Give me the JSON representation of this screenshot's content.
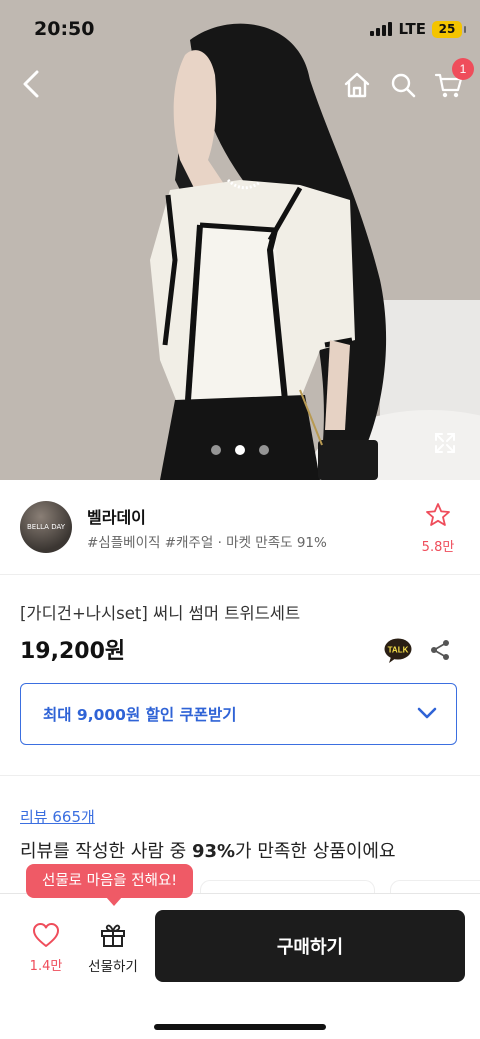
{
  "status_bar": {
    "time": "20:50",
    "network": "LTE",
    "battery": "25"
  },
  "header": {
    "back_icon": "chevron-left-icon",
    "home_icon": "home-icon",
    "search_icon": "search-icon",
    "cart_icon": "cart-icon",
    "cart_count": "1"
  },
  "gallery": {
    "total": 3,
    "active": 2,
    "expand_icon": "expand-icon"
  },
  "shop": {
    "logo_text": "BELLA DAY",
    "name": "벨라데이",
    "tags": "#심플베이직 #캐주얼 · 마켓 만족도 91%",
    "favorite_icon": "star-outline-icon",
    "favorite_count": "5.8만"
  },
  "product": {
    "title": "[가디건+나시set] 써니 썸머 트위드세트",
    "price": "19,200원",
    "talk_label": "TALK",
    "share_icon": "share-icon"
  },
  "coupon": {
    "label": "최대 9,000원 할인 쿠폰받기",
    "chevron_icon": "chevron-down-icon"
  },
  "review": {
    "link": "리뷰 665개",
    "summary_prefix": "리뷰를 작성한 사람 중 ",
    "summary_percent": "93%",
    "summary_suffix": "가 만족한 상품이에요"
  },
  "bottom_bar": {
    "tooltip": "선물로 마음을 전해요!",
    "like_icon": "heart-outline-icon",
    "like_count": "1.4만",
    "gift_icon": "gift-icon",
    "gift_label": "선물하기",
    "buy_label": "구매하기"
  },
  "colors": {
    "accent_blue": "#3b6fe0",
    "accent_red": "#ef4d5b",
    "buy_button": "#1c1c1c"
  }
}
